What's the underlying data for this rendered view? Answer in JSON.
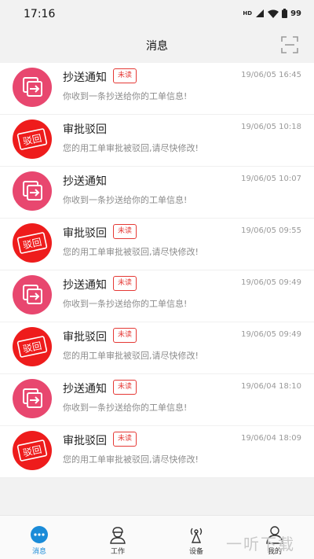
{
  "status": {
    "time": "17:16",
    "hd": "HD",
    "battery": "99"
  },
  "header": {
    "title": "消息"
  },
  "messages": [
    {
      "type": "cc",
      "title": "抄送通知",
      "badge": "未读",
      "time": "19/06/05 16:45",
      "text": "你收到一条抄送给你的工单信息!"
    },
    {
      "type": "reject",
      "title": "审批驳回",
      "badge": "",
      "time": "19/06/05 10:18",
      "text": "您的用工单审批被驳回,请尽快修改!"
    },
    {
      "type": "cc",
      "title": "抄送通知",
      "badge": "",
      "time": "19/06/05 10:07",
      "text": "你收到一条抄送给你的工单信息!"
    },
    {
      "type": "reject",
      "title": "审批驳回",
      "badge": "未读",
      "time": "19/06/05 09:55",
      "text": "您的用工单审批被驳回,请尽快修改!"
    },
    {
      "type": "cc",
      "title": "抄送通知",
      "badge": "未读",
      "time": "19/06/05 09:49",
      "text": "你收到一条抄送给你的工单信息!"
    },
    {
      "type": "reject",
      "title": "审批驳回",
      "badge": "未读",
      "time": "19/06/05 09:49",
      "text": "您的用工单审批被驳回,请尽快修改!"
    },
    {
      "type": "cc",
      "title": "抄送通知",
      "badge": "未读",
      "time": "19/06/04 18:10",
      "text": "你收到一条抄送给你的工单信息!"
    },
    {
      "type": "reject",
      "title": "审批驳回",
      "badge": "未读",
      "time": "19/06/04 18:09",
      "text": "您的用工单审批被驳回,请尽快修改!"
    }
  ],
  "avatar_text": {
    "reject": "驳回"
  },
  "tabs": [
    {
      "label": "消息",
      "icon": "chat-icon",
      "active": true
    },
    {
      "label": "工作",
      "icon": "worker-icon",
      "active": false
    },
    {
      "label": "设备",
      "icon": "device-icon",
      "active": false
    },
    {
      "label": "我的",
      "icon": "user-icon",
      "active": false
    }
  ],
  "watermark": "一听下载",
  "colors": {
    "accent": "#1a8bd8",
    "cc_avatar": "#e8476f",
    "reject_avatar": "#ee1c1c",
    "badge": "#e53935"
  }
}
